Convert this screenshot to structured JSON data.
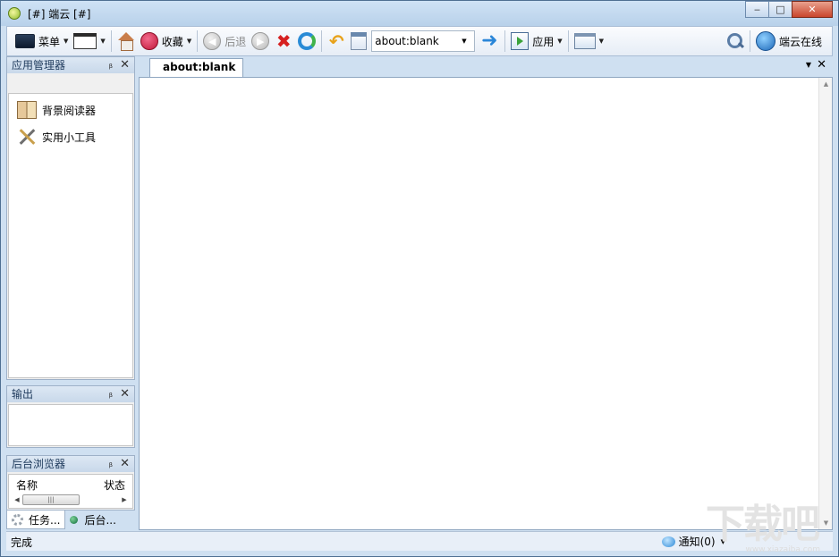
{
  "window": {
    "title": "[#] 端云 [#]",
    "controls": {
      "minimize": "‒",
      "maximize": "□",
      "close": "✕"
    }
  },
  "toolbar": {
    "menu_label": "菜单",
    "favorites_label": "收藏",
    "back_label": "后退",
    "url_value": "about:blank",
    "apps_label": "应用",
    "online_label": "端云在线"
  },
  "panels": {
    "app_manager": {
      "title": "应用管理器",
      "items": [
        {
          "label": "背景阅读器",
          "icon": "book-icon"
        },
        {
          "label": "实用小工具",
          "icon": "tools-icon"
        }
      ]
    },
    "output": {
      "title": "输出"
    },
    "bg_browser": {
      "title": "后台浏览器",
      "col_name": "名称",
      "col_status": "状态"
    },
    "pin_glyph": "ᵦ",
    "close_glyph": "✕"
  },
  "bottom_tabs": [
    {
      "label": "任务...",
      "icon": "gear-icon",
      "active": true
    },
    {
      "label": "后台...",
      "icon": "green-dot-icon",
      "active": false
    }
  ],
  "tabs": [
    {
      "label": "about:blank",
      "active": true
    }
  ],
  "status": {
    "text": "完成",
    "notify_label": "通知(0)"
  },
  "watermark": {
    "text": "下载吧",
    "sub": "www.xiazaiba.com"
  },
  "colors": {
    "accent": "#2a86d8",
    "window_frame": "#cfe0f1",
    "close_button": "#c9452c"
  }
}
